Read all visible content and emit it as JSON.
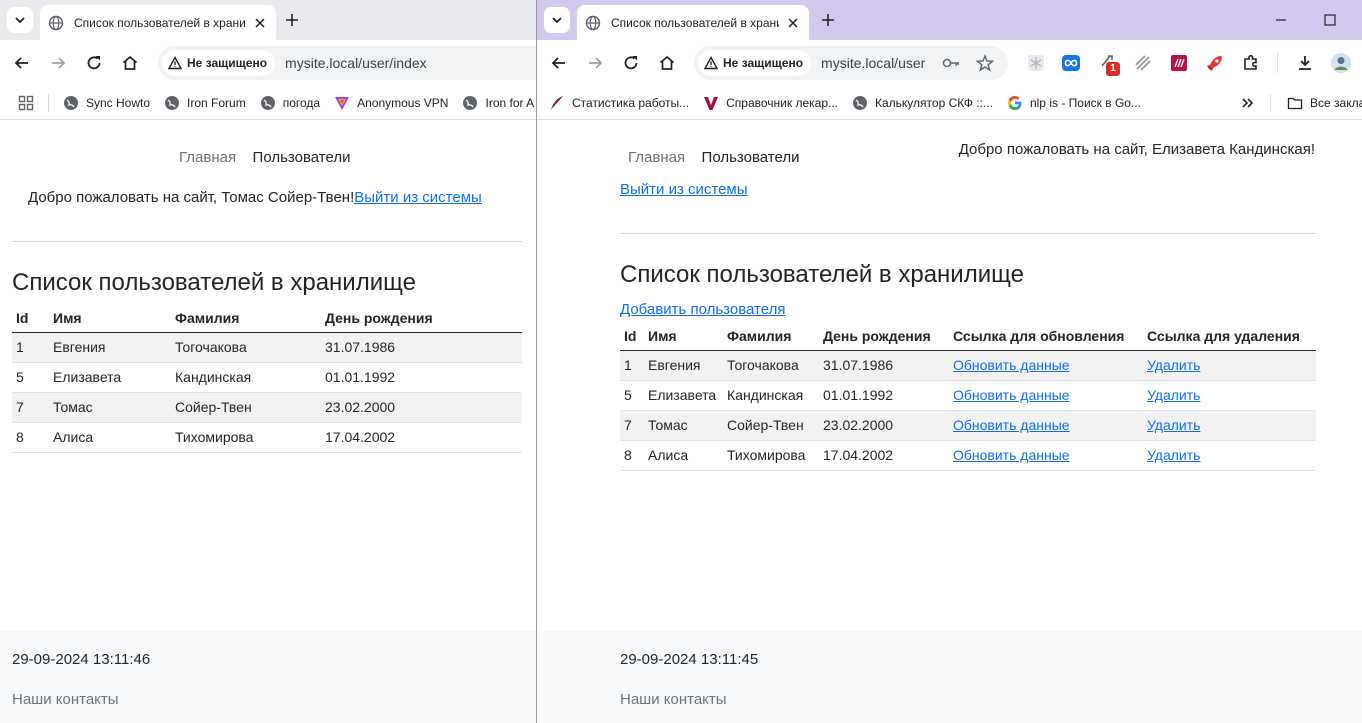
{
  "left_window": {
    "tab": {
      "title": "Список пользователей в хранилище"
    },
    "address": {
      "security_label": "Не защищено",
      "url": "mysite.local/user/index"
    },
    "bookmarks": [
      {
        "label": "Sync Howto",
        "icon": "globe-icon"
      },
      {
        "label": "Iron Forum",
        "icon": "globe-icon"
      },
      {
        "label": "погода",
        "icon": "globe-icon"
      },
      {
        "label": "Anonymous VPN",
        "icon": "vpn-icon"
      },
      {
        "label": "Iron for A",
        "icon": "globe-icon"
      }
    ],
    "page": {
      "nav": {
        "home": "Главная",
        "users": "Пользователи"
      },
      "welcome": "Добро пожаловать на сайт, Томас Сойер-Твен!",
      "logout": "Выйти из системы",
      "heading": "Список пользователей в хранилище",
      "columns": [
        "Id",
        "Имя",
        "Фамилия",
        "День рождения"
      ],
      "rows": [
        [
          "1",
          "Евгения",
          "Тогочакова",
          "31.07.1986"
        ],
        [
          "5",
          "Елизавета",
          "Кандинская",
          "01.01.1992"
        ],
        [
          "7",
          "Томас",
          "Сойер-Твен",
          "23.02.2000"
        ],
        [
          "8",
          "Алиса",
          "Тихомирова",
          "17.04.2002"
        ]
      ],
      "footer": {
        "datetime": "29-09-2024 13:11:46",
        "contacts": "Наши контакты"
      }
    }
  },
  "right_window": {
    "tab": {
      "title": "Список пользователей в хранилище"
    },
    "address": {
      "security_label": "Не защищено",
      "url": "mysite.local/user"
    },
    "extension_badge": "1",
    "bookmarks": [
      {
        "label": "Статистика работы...",
        "icon": "quill-icon"
      },
      {
        "label": "Справочник лекар...",
        "icon": "v-logo-icon"
      },
      {
        "label": "Калькулятор СКФ ::...",
        "icon": "globe-icon"
      },
      {
        "label": "nlp is - Поиск в Go...",
        "icon": "google-icon"
      }
    ],
    "all_bookmarks": "Все закладки",
    "page": {
      "nav": {
        "home": "Главная",
        "users": "Пользователи"
      },
      "welcome": "Добро пожаловать на сайт, Елизавета Кандинская!",
      "logout": "Выйти из системы",
      "heading": "Список пользователей в хранилище",
      "add_user": "Добавить пользователя",
      "columns": [
        "Id",
        "Имя",
        "Фамилия",
        "День рождения",
        "Ссылка для обновления",
        "Ссылка для удаления"
      ],
      "rows": [
        [
          "1",
          "Евгения",
          "Тогочакова",
          "31.07.1986",
          "Обновить данные",
          "Удалить"
        ],
        [
          "5",
          "Елизавета",
          "Кандинская",
          "01.01.1992",
          "Обновить данные",
          "Удалить"
        ],
        [
          "7",
          "Томас",
          "Сойер-Твен",
          "23.02.2000",
          "Обновить данные",
          "Удалить"
        ],
        [
          "8",
          "Алиса",
          "Тихомирова",
          "17.04.2002",
          "Обновить данные",
          "Удалить"
        ]
      ],
      "footer": {
        "datetime": "29-09-2024 13:11:45",
        "contacts": "Наши контакты"
      }
    }
  },
  "colors": {
    "link": "#0d6efd",
    "left_tabbar": "#e8eaed",
    "right_tabbar": "#d3c9ee",
    "stripe": "#f2f2f2"
  }
}
